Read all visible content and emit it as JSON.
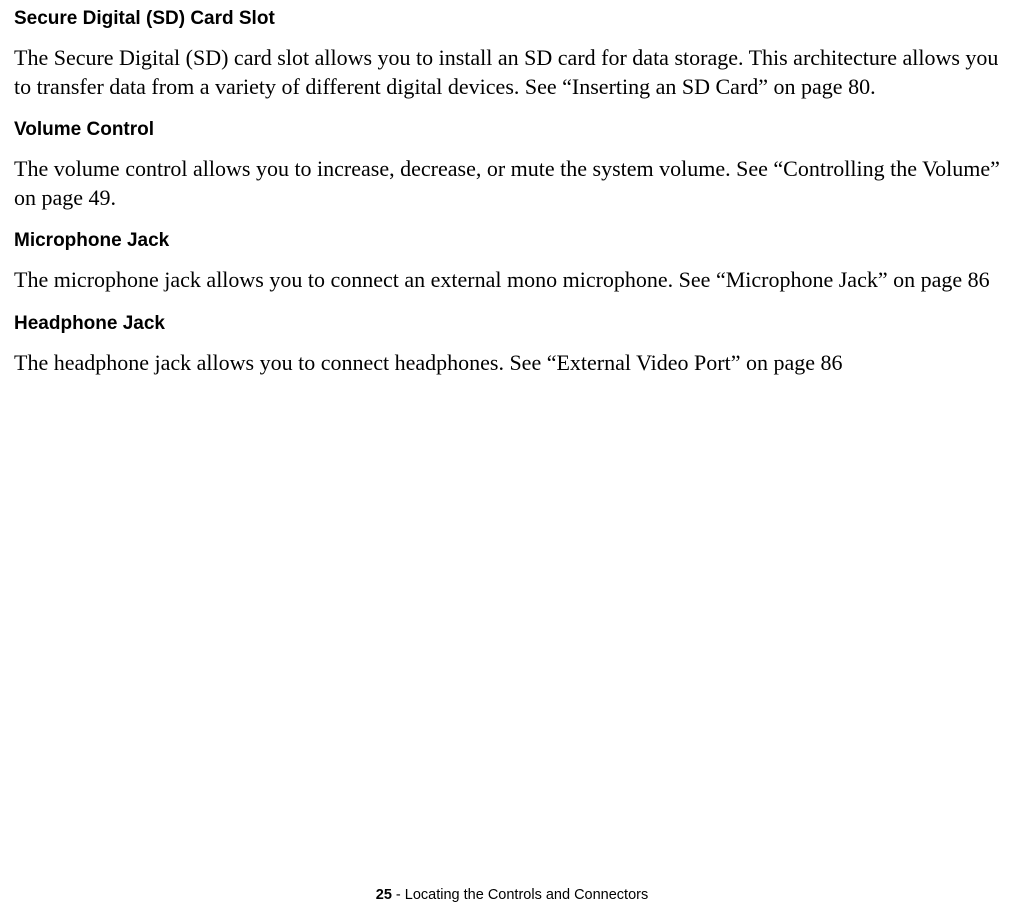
{
  "sections": [
    {
      "heading": "Secure Digital (SD) Card Slot",
      "body": "The Secure Digital (SD) card slot allows you to install an SD card for data storage. This architecture allows you to transfer data from a variety of different digital devices. See “Inserting an SD Card” on page 80."
    },
    {
      "heading": "Volume Control",
      "body": "The volume control allows you to increase, decrease, or mute the system volume. See “Controlling the Volume” on page 49."
    },
    {
      "heading": "Microphone Jack",
      "body": "The microphone jack allows you to connect an external mono microphone. See “Microphone Jack” on page 86"
    },
    {
      "heading": "Headphone Jack",
      "body": "The headphone jack allows you to connect headphones. See “External Video Port” on page 86"
    }
  ],
  "footer": {
    "page_number": "25",
    "separator": " - ",
    "title": "Locating the Controls and Connectors"
  }
}
